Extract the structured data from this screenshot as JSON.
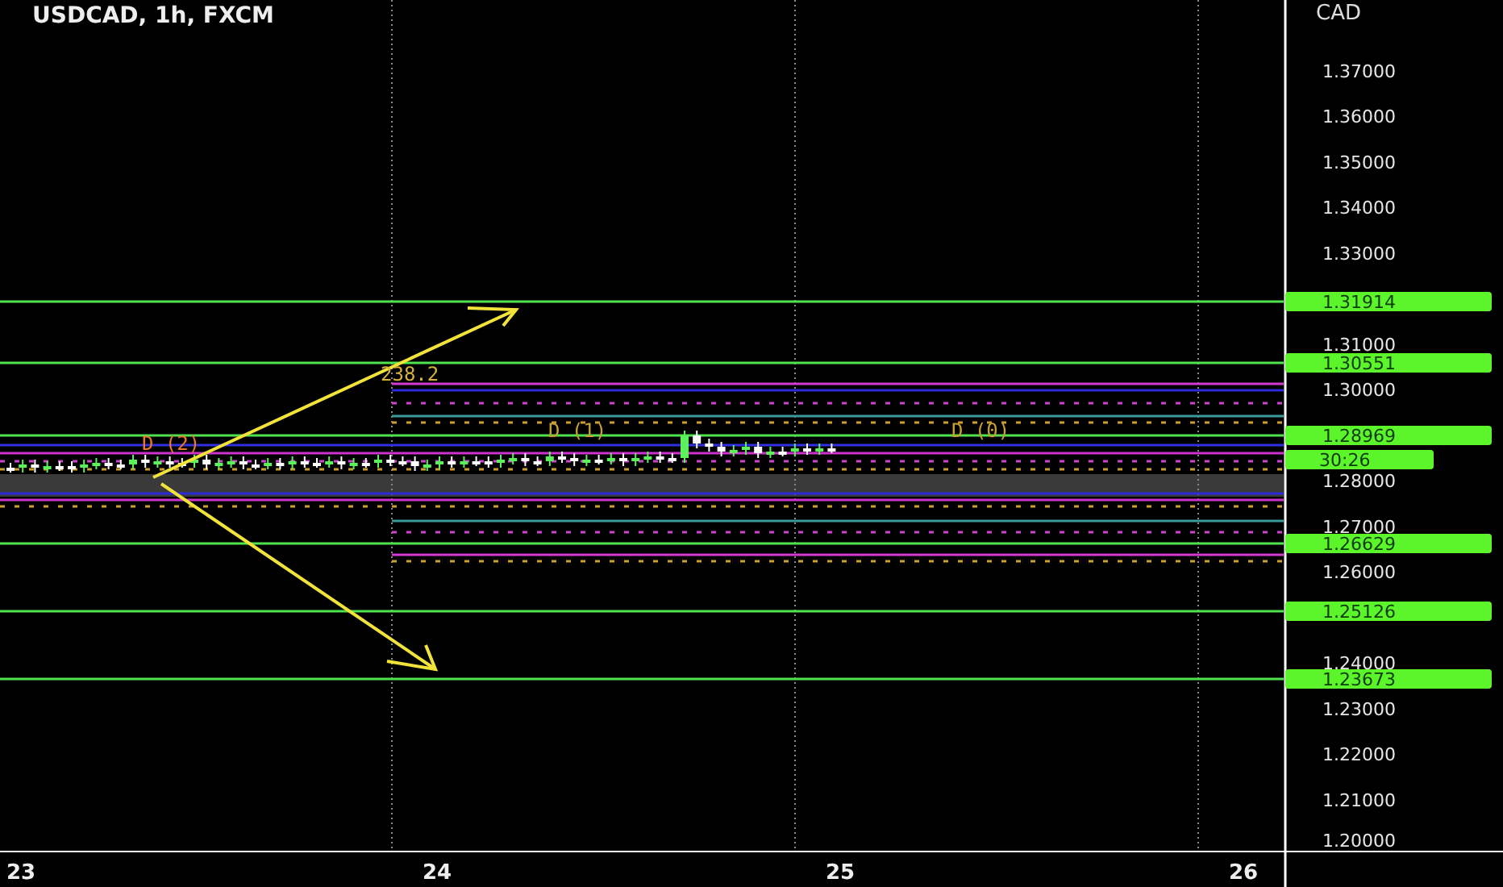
{
  "chart": {
    "title": "USDCAD, 1h, FXCM",
    "currency": "CAD",
    "countdown": "30:26",
    "fib_labels": [
      {
        "text": "238.2",
        "color": "#d4b13a"
      },
      {
        "text": "D (2)",
        "color": "#e8782a"
      },
      {
        "text": "D (1)",
        "color": "#c9a032"
      },
      {
        "text": "D (0)",
        "color": "#c9a032"
      }
    ],
    "price_axis": [
      "1.37000",
      "1.36000",
      "1.35000",
      "1.34000",
      "1.33000",
      "1.31000",
      "1.30000",
      "1.28000",
      "1.27000",
      "1.26000",
      "1.24000",
      "1.23000",
      "1.22000",
      "1.21000",
      "1.20000"
    ],
    "levels": [
      "1.31914",
      "1.30551",
      "1.28969",
      "1.26629",
      "1.25126",
      "1.23673"
    ],
    "time_axis": [
      "23",
      "24",
      "25",
      "26"
    ]
  }
}
